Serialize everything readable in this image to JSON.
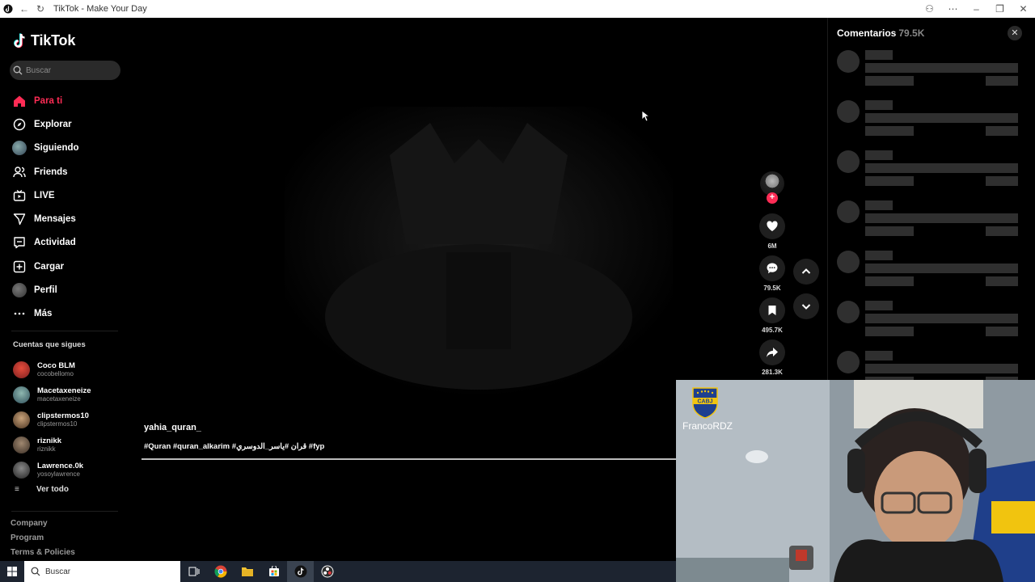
{
  "browser": {
    "title": "TikTok - Make Your Day",
    "icons": [
      "tiktok-favicon",
      "back-arrow-icon",
      "refresh-icon",
      "translate-icon",
      "more-icon",
      "minimize-icon",
      "restore-icon",
      "close-icon"
    ]
  },
  "sidebar": {
    "logo_text": "TikTok",
    "search_placeholder": "Buscar",
    "nav": [
      {
        "label": "Para ti",
        "icon": "home-icon",
        "active": true
      },
      {
        "label": "Explorar",
        "icon": "compass-icon"
      },
      {
        "label": "Siguiendo",
        "icon": "avatar"
      },
      {
        "label": "Friends",
        "icon": "friends-icon"
      },
      {
        "label": "LIVE",
        "icon": "live-tv-icon"
      },
      {
        "label": "Mensajes",
        "icon": "send-icon"
      },
      {
        "label": "Actividad",
        "icon": "activity-icon"
      },
      {
        "label": "Cargar",
        "icon": "upload-plus-icon"
      },
      {
        "label": "Perfil",
        "icon": "avatar"
      },
      {
        "label": "Más",
        "icon": "more-dots-icon"
      }
    ],
    "following_title": "Cuentas que sigues",
    "following": [
      {
        "name": "Coco BLM",
        "user": "cocobellomo",
        "color": "#c0392b"
      },
      {
        "name": "Macetaxeneize",
        "user": "macetaxeneize",
        "color": "#5a8a9a"
      },
      {
        "name": "clipstermos10",
        "user": "clipstermos10",
        "color": "#8a6d4a"
      },
      {
        "name": "riznikk",
        "user": "riznikk",
        "color": "#6a5a4a"
      },
      {
        "name": "Lawrence.0k",
        "user": "yosoylawrence",
        "color": "#4a4a4a"
      }
    ],
    "see_all": "Ver todo",
    "footer": [
      "Company",
      "Program",
      "Terms & Policies"
    ]
  },
  "video": {
    "username": "yahia_quran_",
    "description": "#Quran #quran_alkarim #قران #ياسر_الدوسري #fyp",
    "progress": 1.0
  },
  "actions": {
    "likes": "6M",
    "comments": "79.5K",
    "saves": "495.7K",
    "shares": "281.3K"
  },
  "comments_panel": {
    "title": "Comentarios",
    "count": "79.5K",
    "skeleton_rows": 7
  },
  "webcam": {
    "streamer_name": "FrancoRDZ"
  },
  "taskbar": {
    "search_placeholder": "Buscar",
    "apps": [
      "task-view-icon",
      "chrome-icon",
      "file-explorer-icon",
      "store-icon",
      "tiktok-icon",
      "obs-icon"
    ]
  }
}
